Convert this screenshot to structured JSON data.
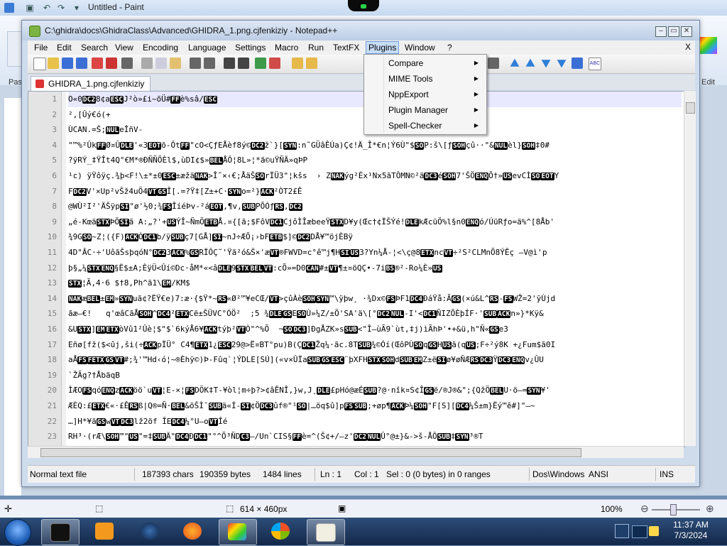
{
  "paint": {
    "title": "Untitled - Paint",
    "ribbon_left_label": "Pas",
    "ribbon_right_label": "Edit colors",
    "image_size": "614 × 460px",
    "zoom": "100%"
  },
  "npp": {
    "title": "C:\\ghidra\\docs\\GhidraClass\\Advanced\\GHIDRA_1.png.cjfenkiziy - Notepad++",
    "menu": [
      "File",
      "Edit",
      "Search",
      "View",
      "Encoding",
      "Language",
      "Settings",
      "Macro",
      "Run",
      "TextFX",
      "Plugins",
      "Window",
      "?"
    ],
    "menu_close": "X",
    "active_menu": "Plugins",
    "tab_label": "GHIDRA_1.png.cjfenkiziy",
    "plugins_menu": [
      {
        "label": "Compare"
      },
      {
        "label": "MIME Tools"
      },
      {
        "label": "NppExport"
      },
      {
        "label": "Plugin Manager"
      },
      {
        "label": "Spell-Checker"
      }
    ],
    "status": {
      "type": "Normal text file",
      "chars": "187393 chars",
      "bytes": "190359 bytes",
      "lines": "1484 lines",
      "ln": "Ln : 1",
      "col": "Col : 1",
      "sel": "Sel : 0 (0 bytes) in 0 ranges",
      "eol": "Dos\\Windows",
      "encoding": "ANSI",
      "mode": "INS"
    },
    "lines": [
      "O«0[DC2]8¢a[ESC]J²ò»£i~õÜ#[FF]è%sâ/[ESC]",
      "²,[Ûý€ó(+",
      "ÙCAN.=Š;[NUL]eÎñV-",
      "\"™%²Ûk[FF]Ø¤Û[DLE]'«3[EOT]õ-Ôt[FF]\"cO<ÇƒEÅèf8ý©[DC2]ž`}[[SYN]:n˜GÜâÊÚa)Ç¢!Ä_Î*€n¦Ý6Ù\"$[SO]P:š\\[ƒ[SOH]çû··\"&[NUL]èl}[SOH]‡0#",
      "?ÿRÝ_‡ŸÎt4Q°€M*®ÐÑÑÕÈl$,ùDI¢$»[BEL]ÅÔ¦8L»¦*ã©uŸÑÄ»qÞP",
      "¹c) ÿŸôÿç.¾þ<F!\\±*±0[ESC]±æžä[NAK]>Î˜×‹€;ÅäŠ[SO]rÏÜ3\"¦kšs  › Z[NAK]ýg²Éx¹Nx5ãTÔMN©²ä[DC3]é[SOH]7'ŠÖ[ENQ]Õ†»[US]evCÌ[SO][EOT]Y",
      "F[DC2]V'×Up²vŠž4uÖ4[VT][GS]Î[.=?Ÿ‡[Z±+C·[SYN]o=²}[ACK]²ÒT2£Ê",
      "@WÙ²I²'ÄŠÿp[SI]\"ø'½0;¾[FS]ÎíéÞv-²á[EOT],¶v,[SUB]PÕÓƒ[RS],[DC2]",
      "„é-Kœä[STX]ÞÖ[SI]ã A:„?'+[US]ÝÎ~ÑmÖ[ETB]Å.¤{[ã;$FôV[DC1]CjôÌÎæbeeŸ[STX]D¥y(Œc†¢ÏŠÝé![DLE]kÆcüÖ%l§n0[ENQ]ó/ÚüRƒo=ä%^[8Åb'",
      "¾9G[SO]~Z¦({F)[ACK]Ò[DC1]b/ÿ[SUB]ç7[GÅ][SI]~nJ÷ÆÕ¡›bF[ETB]$]©[DC2]DÅ¥™öjÈBÿ",
      "4D\"ÂC·÷'UôãŠsþqóN°[DC2]3[ACK]%[GS]RÏÔÇ˜'Ÿä²ó&Š×'æ[VT]®FWVD=c°ê™j¶H[SI][US]3?Yn¼Å-¦<\\ç@8[ETX]nc[VT]÷²S²CLMnÕ8ÝÊç –V@ì'p",
      "þ§„¼[STX][ENQ]§Ë$±A;ÈÿÜ<Ûí©Dc·åM*«<â[DLE]9[STX][BEL][VT]:cÕ»=D0[CAN]#±[VT]¶±¤öQÇ•-7i[BS]®²-Ro¼È»[US]",
      "[STX]¦Ã,4·6 $†8,Ph^ã1\\[EM]/KM$",
      "[NAK]æ[BEL]±[EM]»[SYN]uã¢?ËŸ€e)7:æ·{$Ÿ*~[RS]«Ø²™¥eCŒ/[VT]>çûÀè[SOH][SYN]™\\ÿþw¸ ·¾Dx©[FS]ÞF1[DC4]ÐáŸå:Ã[GS](×ú&L^[RS]-[FS]WŽ=2'ÿÙjd",
      "ãæ–€!   q'œâCãÅ[SOH]^[DC4]²[ETX]Cë±ŠÜVC°ÓÖ²  ;5 ¾[DLE][GS]E[SO]Ù»¼Z/±Ö'SA'ä\\[°[DC2][NUL]-I'<[DC1]ÑIZÕÈþÍF·'[SUB][ACK]n»}*Kÿ&",
      "&U[STX]][EM][ETX]òVû1²Ûè¦$\"$`6kýÅ6¥[ACK]týþ²[VT]Ò\"^%Õ  ¬[SO][DC3]]ÐgÅZK»s[SUB]<\"Î–ùÃ9`ùt,‡j)ìÃhÞ'•+&ü,h\"Ñ«[GS]e3",
      "Eñø[fž($<ûj,ši(÷[ACK]pÏÜ° C4¶[ETX]1¿[ESC]29@>Ë¤BT°pu)B(Ç[DC1]Žq¼·ãc.8T[SUB]¾©Óí(ŒôPÙ[SO]q[GS]H[US]ã(q[US];F÷²ý8K +¿Fum$ã0I",
      "aÅ[FS][FETX][GS][VT]#;¾'™Hd‹ó¦~®Èhÿ©)Þ-Fûq`¦ÝDLE[SÚ](«v×ÛÏa[SUB][GS][ESC]¨þXFH[STX][SOH]d[SUB][EM]Z±ë[SI]ø¥øÑÆ[RS][DC3]Ÿ[DC3][ENQ]v¿ÛU",
      "`ŽÃg?†ÅbäqB",
      "ÌÆO[FS]qó[ENQ]z[ACK]öö`u[VT]¦E-×¦[FS]DÖK‡T-¥òl¦m÷þ?>¢âÊNÎ,}w,J¸[DLE]£pHó@æÉ[SUB]?@·nîk¤S¢Î[GS]ë/®J®&\";{QžÖ[BEL]U·ö–=[SYN]¥'",
      "ÆÈQ:£[ETX]€«·£Ê[RS]ß|Q®=Ñ·[BEL]&õŠÌ¯[SUB]ä«Í-[SI]¢Ö[DC3]ûf®\"¹[SO]|…öq$û]p[FS][SUB];+øp¶[ACK]Þ¼[SOH]\"F[S][[DC4]¼Š±m}Ëý™ê#]\"—~",
      "…]H*¥ä[GS]w[VT][DC3]lž2õf ÎE[DC4]¼°U—o[VT]Îé",
      "RH³·(rÆ\\[SOH]™\"[US]\"=‡[SUB]Ä\"[DC4]Ð[DC1]\"°^Õ³ÑD[C3]—/Un`CIS§[FF]è=^(Š¢+/—z'[DC2][NUL]Û°@±}&->š-ÅÔ[SUB]‡[SYN]³®T"
    ]
  }
}
